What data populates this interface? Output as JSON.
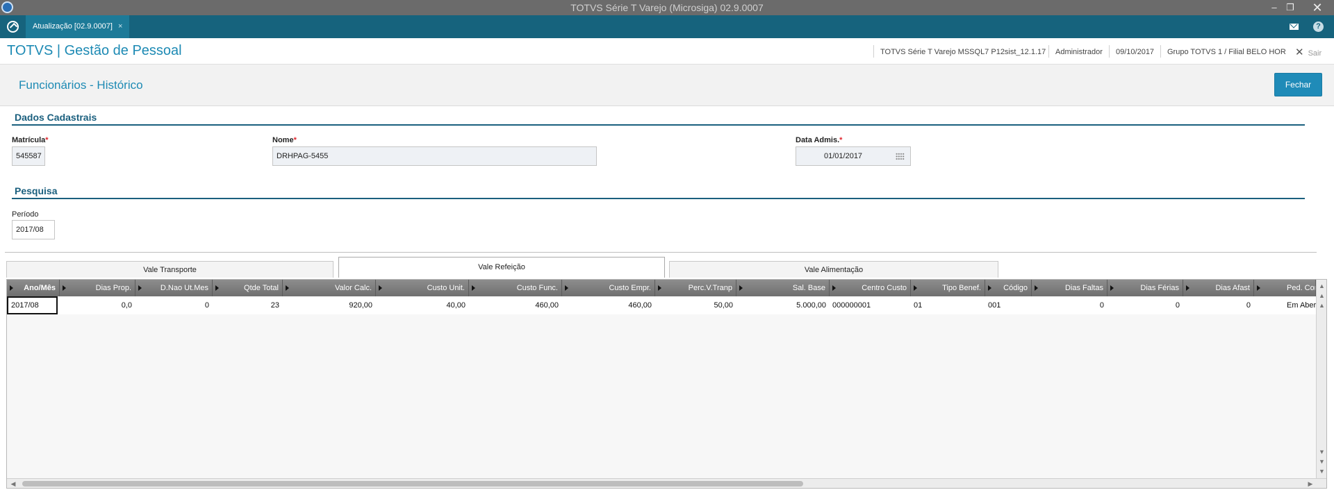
{
  "window": {
    "title": "TOTVS Série T Varejo (Microsiga) 02.9.0007",
    "minimize": "–",
    "restore": "❐",
    "close": "✕"
  },
  "tabbar": {
    "tab_label": "Atualização [02.9.0007]",
    "tab_close": "×"
  },
  "header": {
    "brand": "TOTVS | Gestão de Pessoal",
    "environment": "TOTVS Série T Varejo MSSQL7 P12sist_12.1.17",
    "user": "Administrador",
    "date": "09/10/2017",
    "branch": "Grupo TOTVS 1 / Filial BELO HOR",
    "exit_label": "Sair",
    "exit_icon": "✕"
  },
  "page": {
    "title": "Funcionários - Histórico",
    "close_button": "Fechar"
  },
  "form": {
    "section_registration": "Dados Cadastrais",
    "matricula_label": "Matrícula",
    "matricula_value": "545587",
    "nome_label": "Nome",
    "nome_value": "DRHPAG-5455",
    "admissao_label": "Data Admis.",
    "admissao_value": "01/01/2017",
    "required_mark": "*",
    "section_search": "Pesquisa",
    "periodo_label": "Período",
    "periodo_value": "2017/08"
  },
  "subtabs": [
    "Vale Transporte",
    "Vale Refeição",
    "Vale Alimentação"
  ],
  "grid": {
    "columns": [
      "Ano/Mês",
      "Dias Prop.",
      "D.Nao Ut.Mes",
      "Qtde Total",
      "Valor Calc.",
      "Custo Unit.",
      "Custo Func.",
      "Custo Empr.",
      "Perc.V.Tranp",
      "Sal. Base",
      "Centro Custo",
      "Tipo Benef.",
      "Código",
      "Dias Faltas",
      "Dias Férias",
      "Dias Afast",
      "Ped. Compra"
    ],
    "rows": [
      [
        "2017/08",
        "0,0",
        "0",
        "23",
        "920,00",
        "40,00",
        "460,00",
        "460,00",
        "50,00",
        "5.000,00",
        "000000001",
        "01",
        "001",
        "0",
        "0",
        "0",
        "Em Aberto"
      ]
    ]
  },
  "colors": {
    "accent": "#1d8ab4",
    "tabbar": "#16637d",
    "section": "#1a5f7e",
    "required": "#e0262e"
  }
}
